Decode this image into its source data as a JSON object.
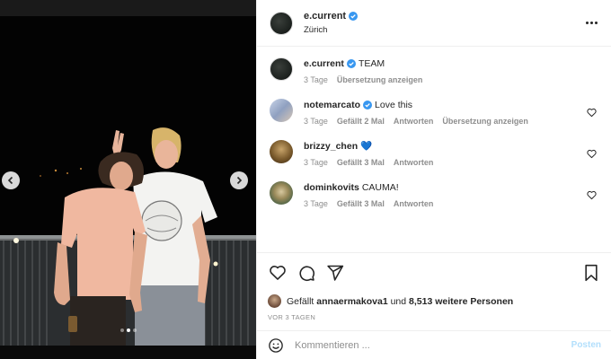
{
  "post": {
    "author": "e.current",
    "location": "Zürich",
    "caption_user": "e.current",
    "caption_text": "TEAM",
    "caption_time": "3 Tage",
    "caption_translate": "Übersetzung anzeigen",
    "carousel_dots": 3,
    "carousel_active": 1
  },
  "comments": [
    {
      "user": "notemarcato",
      "verified": true,
      "text": "Love this",
      "time": "3 Tage",
      "likes": "Gefällt 2 Mal",
      "reply": "Antworten",
      "translate": "Übersetzung anzeigen"
    },
    {
      "user": "brizzy_chen",
      "verified": false,
      "text": "💙",
      "time": "3 Tage",
      "likes": "Gefällt 3 Mal",
      "reply": "Antworten"
    },
    {
      "user": "dominkovits",
      "verified": false,
      "text": "CAUMA!",
      "time": "3 Tage",
      "likes": "Gefällt 3 Mal",
      "reply": "Antworten"
    }
  ],
  "likes_line": {
    "prefix": "Gefällt",
    "user": "annaermakova1",
    "middle": "und",
    "count": "8,513 weitere Personen"
  },
  "posted_ago": "VOR 3 TAGEN",
  "composer": {
    "placeholder": "Kommentieren ...",
    "post_label": "Posten"
  },
  "colors": {
    "verified": "#3897f0",
    "post_disabled": "#b2dffc",
    "meta": "#8e8e8e"
  },
  "icons": [
    "chevron-left-icon",
    "chevron-right-icon",
    "more-icon",
    "verified-icon",
    "heart-icon",
    "comment-icon",
    "share-icon",
    "bookmark-icon",
    "emoji-icon"
  ]
}
